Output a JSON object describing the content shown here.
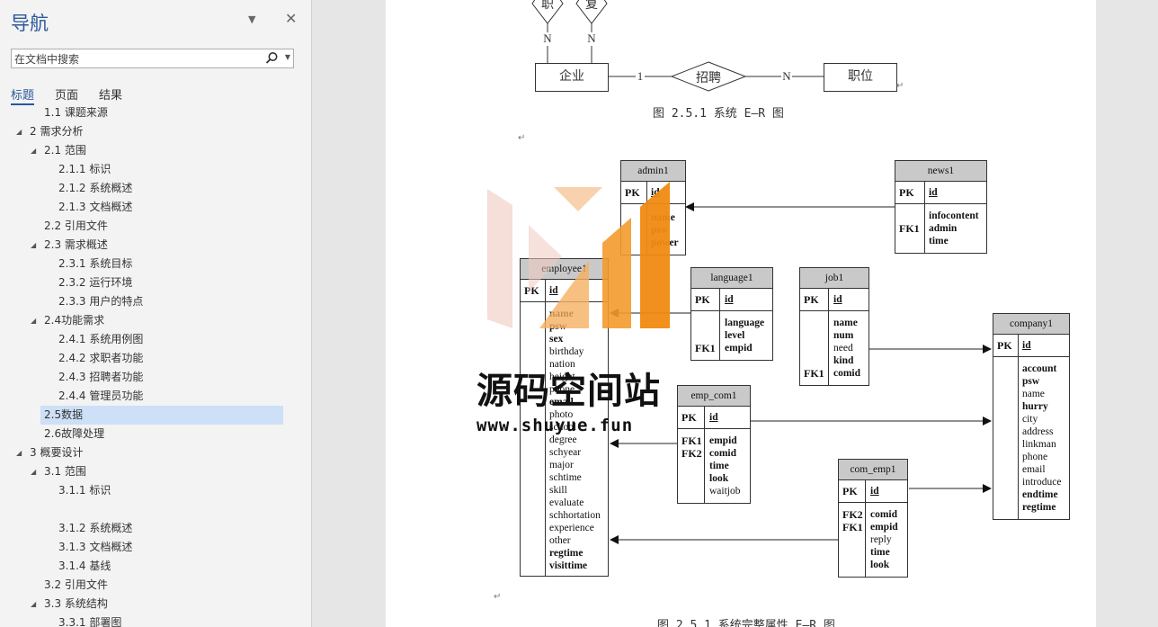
{
  "nav": {
    "title": "导航",
    "search_placeholder": "在文档中搜索",
    "tabs": [
      "标题",
      "页面",
      "结果"
    ],
    "items": [
      {
        "label": "1.1 课题来源",
        "level": 2,
        "toggle": ""
      },
      {
        "label": "2 需求分析",
        "level": 1,
        "toggle": "expanded"
      },
      {
        "label": "2.1 范围",
        "level": 2,
        "toggle": "expanded"
      },
      {
        "label": "2.1.1 标识",
        "level": 3,
        "toggle": ""
      },
      {
        "label": "2.1.2 系统概述",
        "level": 3,
        "toggle": ""
      },
      {
        "label": "2.1.3 文档概述",
        "level": 3,
        "toggle": ""
      },
      {
        "label": "2.2 引用文件",
        "level": 2,
        "toggle": ""
      },
      {
        "label": "2.3 需求概述",
        "level": 2,
        "toggle": "expanded"
      },
      {
        "label": "2.3.1 系统目标",
        "level": 3,
        "toggle": ""
      },
      {
        "label": "2.3.2 运行环境",
        "level": 3,
        "toggle": ""
      },
      {
        "label": "2.3.3 用户的特点",
        "level": 3,
        "toggle": ""
      },
      {
        "label": "2.4功能需求",
        "level": 2,
        "toggle": "expanded"
      },
      {
        "label": "2.4.1 系统用例图",
        "level": 3,
        "toggle": ""
      },
      {
        "label": "2.4.2 求职者功能",
        "level": 3,
        "toggle": ""
      },
      {
        "label": "2.4.3 招聘者功能",
        "level": 3,
        "toggle": ""
      },
      {
        "label": "2.4.4 管理员功能",
        "level": 3,
        "toggle": ""
      },
      {
        "label": "2.5数据",
        "level": 2,
        "toggle": "",
        "selected": true
      },
      {
        "label": "2.6故障处理",
        "level": 2,
        "toggle": ""
      },
      {
        "label": "3 概要设计",
        "level": 1,
        "toggle": "expanded"
      },
      {
        "label": "3.1 范围",
        "level": 2,
        "toggle": "expanded"
      },
      {
        "label": "3.1.1 标识",
        "level": 3,
        "toggle": ""
      },
      {
        "label": "",
        "level": 3,
        "toggle": ""
      },
      {
        "label": "3.1.2 系统概述",
        "level": 3,
        "toggle": ""
      },
      {
        "label": "3.1.3 文档概述",
        "level": 3,
        "toggle": ""
      },
      {
        "label": "3.1.4 基线",
        "level": 3,
        "toggle": ""
      },
      {
        "label": "3.2 引用文件",
        "level": 2,
        "toggle": ""
      },
      {
        "label": "3.3 系统结构",
        "level": 2,
        "toggle": "expanded"
      },
      {
        "label": "3.3.1 部署图",
        "level": 3,
        "toggle": ""
      }
    ]
  },
  "document": {
    "er_top": {
      "diamond_top_left": "职",
      "diamond_top_right": "复",
      "n_left": "N",
      "n_right": "N",
      "entity_left": "企业",
      "card_1": "1",
      "relation": "招聘",
      "card_n": "N",
      "entity_right": "职位",
      "caption": "图 2.5.1  系统 E—R 图"
    },
    "caption_bottom": "图 2.5.1  系统完整属性 E—R 图",
    "tables": {
      "admin1": {
        "name": "admin1",
        "pk": "PK",
        "pk_field": "id",
        "fields": [
          "name",
          "psw",
          "power"
        ]
      },
      "news1": {
        "name": "news1",
        "pk": "PK",
        "pk_field": "id",
        "fk": "FK1",
        "fields": [
          "infocontent",
          "admin",
          "time"
        ]
      },
      "employee1": {
        "name": "employee1",
        "pk": "PK",
        "pk_field": "id",
        "fields": [
          "name",
          "psw",
          "sex",
          "birthday",
          "nation",
          "height",
          "phone",
          "email",
          "photo",
          "school",
          "degree",
          "schyear",
          "major",
          "schtime",
          "skill",
          "evaluate",
          "schhortation",
          "experience",
          "other",
          "regtime",
          "visittime"
        ]
      },
      "language1": {
        "name": "language1",
        "pk": "PK",
        "pk_field": "id",
        "fk": "FK1",
        "fields": [
          "language",
          "level",
          "empid"
        ]
      },
      "job1": {
        "name": "job1",
        "pk": "PK",
        "pk_field": "id",
        "fk": "FK1",
        "fields": [
          "name",
          "num",
          "need",
          "kind",
          "comid"
        ]
      },
      "company1": {
        "name": "company1",
        "pk": "PK",
        "pk_field": "id",
        "fields": [
          "account",
          "psw",
          "name",
          "hurry",
          "city",
          "address",
          "linkman",
          "phone",
          "email",
          "introduce",
          "endtime",
          "regtime"
        ]
      },
      "emp_com1": {
        "name": "emp_com1",
        "pk": "PK",
        "pk_field": "id",
        "fk1": "FK1",
        "fk2": "FK2",
        "fields": [
          "empid",
          "comid",
          "time",
          "look",
          "waitjob"
        ]
      },
      "com_emp1": {
        "name": "com_emp1",
        "pk": "PK",
        "pk_field": "id",
        "fk1": "FK2",
        "fk2": "FK1",
        "fields": [
          "comid",
          "empid",
          "reply",
          "time",
          "look"
        ]
      }
    },
    "watermark": {
      "title": "源码空间站",
      "url": "www.shuyue.fun"
    }
  }
}
